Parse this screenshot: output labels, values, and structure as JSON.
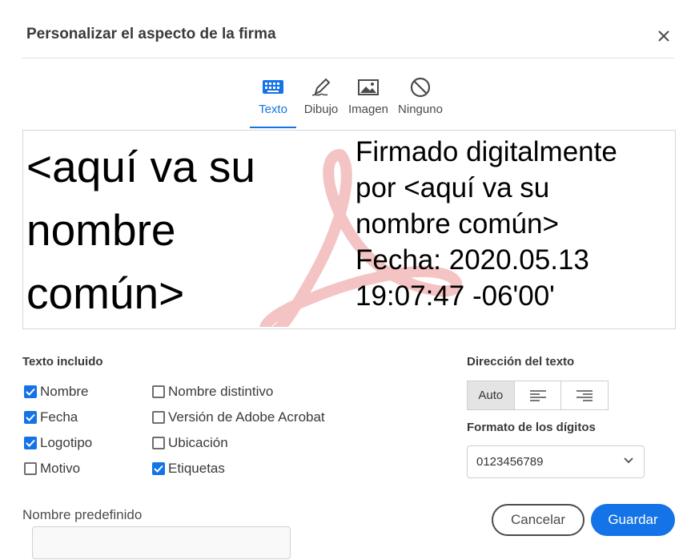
{
  "dialog": {
    "title": "Personalizar el aspecto de la firma"
  },
  "tabs": [
    {
      "label": "Texto",
      "icon": "keyboard-icon",
      "active": true
    },
    {
      "label": "Dibujo",
      "icon": "pen-icon",
      "active": false
    },
    {
      "label": "Imagen",
      "icon": "image-icon",
      "active": false
    },
    {
      "label": "Ninguno",
      "icon": "none-icon",
      "active": false
    }
  ],
  "preview": {
    "name_lines": [
      "<aquí va su",
      "nombre",
      "común>"
    ],
    "detail_lines": [
      "Firmado digitalmente",
      "por <aquí va su",
      "nombre común>",
      "Fecha: 2020.05.13",
      "19:07:47 -06'00'"
    ]
  },
  "included_text": {
    "title": "Texto incluido",
    "options": [
      {
        "label": "Nombre",
        "checked": true
      },
      {
        "label": "Fecha",
        "checked": true
      },
      {
        "label": "Logotipo",
        "checked": true
      },
      {
        "label": "Motivo",
        "checked": false
      },
      {
        "label": "Nombre distintivo",
        "checked": false
      },
      {
        "label": "Versión de Adobe Acrobat",
        "checked": false
      },
      {
        "label": "Ubicación",
        "checked": false
      },
      {
        "label": "Etiquetas",
        "checked": true
      }
    ]
  },
  "text_direction": {
    "title": "Dirección del texto",
    "options": [
      {
        "label": "Auto",
        "active": true
      },
      {
        "icon": "align-left-icon",
        "active": false
      },
      {
        "icon": "align-right-icon",
        "active": false
      }
    ]
  },
  "digit_format": {
    "title": "Formato de los dígitos",
    "value": "0123456789"
  },
  "default_name": {
    "label": "Nombre predefinido",
    "value": ""
  },
  "buttons": {
    "cancel": "Cancelar",
    "save": "Guardar"
  },
  "colors": {
    "accent": "#1473e6",
    "logo": "#f2b8b8"
  }
}
